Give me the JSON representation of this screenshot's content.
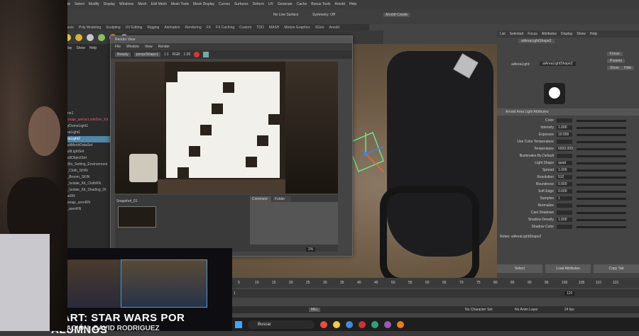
{
  "menubar": [
    "Create",
    "Select",
    "Modify",
    "Display",
    "Windows",
    "Mesh",
    "Edit Mesh",
    "Mesh Tools",
    "Mesh Display",
    "Curves",
    "Surfaces",
    "Deform",
    "UV",
    "Generate",
    "Cache",
    "Bonus Tools",
    "Arnold",
    "Help"
  ],
  "status": {
    "workspace": "Arnold-Create",
    "no_live": "No Live Surface",
    "symmetry": "Symmetry: Off"
  },
  "shelf_tabs": [
    "Surfaces",
    "Poly Modeling",
    "Sculpting",
    "UV Editing",
    "Rigging",
    "Animation",
    "Rendering",
    "FX",
    "FX Caching",
    "Custom",
    "TDO",
    "MASH",
    "Motion Graphics",
    "XGen",
    "Arnold"
  ],
  "outliner": {
    "menu": [
      "Display",
      "Show",
      "Help"
    ],
    "items": [
      {
        "label": "pPlane1",
        "state": "normal"
      },
      {
        "label": "personaje_arena:LookDev_Kit",
        "state": "red"
      },
      {
        "label": "aiSkyDomeLight1",
        "state": "normal"
      },
      {
        "label": "aiAreaLight1",
        "state": "normal"
      },
      {
        "label": "aiAreaLight2",
        "state": "selected"
      },
      {
        "label": "defaultMeshDataSet",
        "state": "normal"
      },
      {
        "label": "defaultLightSet",
        "state": "normal"
      },
      {
        "label": "defaultObjectSet",
        "state": "normal"
      },
      {
        "label": "Ars_Mo_Setting_Environment",
        "state": "normal"
      },
      {
        "label": "Cart_Cloth_SHIN",
        "state": "normal"
      },
      {
        "label": "Cart_Broom_SKIN",
        "state": "normal"
      },
      {
        "label": "Cart_Isolate_Kit_ClothRN",
        "state": "normal"
      },
      {
        "label": "Cart_Isolate_Kit_Shading_Dt",
        "state": "normal"
      },
      {
        "label": "sceneRN",
        "state": "normal"
      },
      {
        "label": "personaje_arenRN",
        "state": "normal"
      },
      {
        "label": "cola_arenRN",
        "state": "normal"
      }
    ]
  },
  "render_view": {
    "title": "Render View",
    "menu": [
      "File",
      "Window",
      "View",
      "Render"
    ],
    "toolbar": [
      "Beauty",
      "persp/Shape1",
      "1:1",
      "RGB",
      "1.00"
    ],
    "snapshot_label": "Snapshot_01",
    "tabs": [
      "Comment",
      "Folder"
    ],
    "zoom": "2%"
  },
  "attribute_editor": {
    "tabs": [
      "List",
      "Selected",
      "Focus",
      "Attributes",
      "Display",
      "Show",
      "Help"
    ],
    "node_tab": "aiAreaLightShape2",
    "shape_label": "aiAreaLight:",
    "shape_value": "aiAreaLightShape2",
    "buttons_right": [
      "Focus",
      "Presets",
      "Show",
      "Hide"
    ],
    "section": "Arnold Area Light Attributes",
    "rows": [
      {
        "label": "Color",
        "value": ""
      },
      {
        "label": "Intensity",
        "value": "1.000"
      },
      {
        "label": "Exposure",
        "value": "10.000"
      },
      {
        "label": "Use Color Temperature",
        "value": ""
      },
      {
        "label": "Temperature",
        "value": "6500.000"
      },
      {
        "label": "Illuminates By Default",
        "value": ""
      },
      {
        "label": "Light Shape",
        "value": "quad"
      },
      {
        "label": "Spread",
        "value": "1.000"
      },
      {
        "label": "Resolution",
        "value": "512"
      },
      {
        "label": "Roundness",
        "value": "0.000"
      },
      {
        "label": "Soft Edge",
        "value": "0.000"
      },
      {
        "label": "Samples",
        "value": "1"
      },
      {
        "label": "Normalize",
        "value": ""
      },
      {
        "label": "Cast Shadows",
        "value": ""
      },
      {
        "label": "Shadow Density",
        "value": "1.000"
      },
      {
        "label": "Shadow Color",
        "value": ""
      }
    ],
    "notes": "Notes: aiAreaLightShape2",
    "bottom": [
      "Select",
      "Load Attributes",
      "Copy Tab"
    ]
  },
  "timeline": {
    "ticks": [
      "5",
      "10",
      "15",
      "20",
      "25",
      "30",
      "35",
      "40",
      "45",
      "50",
      "55",
      "60",
      "65",
      "70",
      "75",
      "80",
      "85",
      "90",
      "95",
      "100",
      "105",
      "110",
      "115"
    ],
    "start": "1",
    "end": "120",
    "current": "1"
  },
  "command_line": {
    "label": "MEL",
    "char_set": "No Character Set",
    "anim_layer": "No Anim Layer",
    "fps": "24 fps"
  },
  "taskbar": {
    "search": "Buscar"
  },
  "slide": {
    "title": "N ART: STAR WARS POR ALUMNOS",
    "subtitle": "CREACIÓN: DAVID RODRIGUEZ"
  },
  "colors": {
    "selection": "#5285a6",
    "outliner_red": "#e35b7a",
    "viewport_floor": "#6b5a48"
  }
}
